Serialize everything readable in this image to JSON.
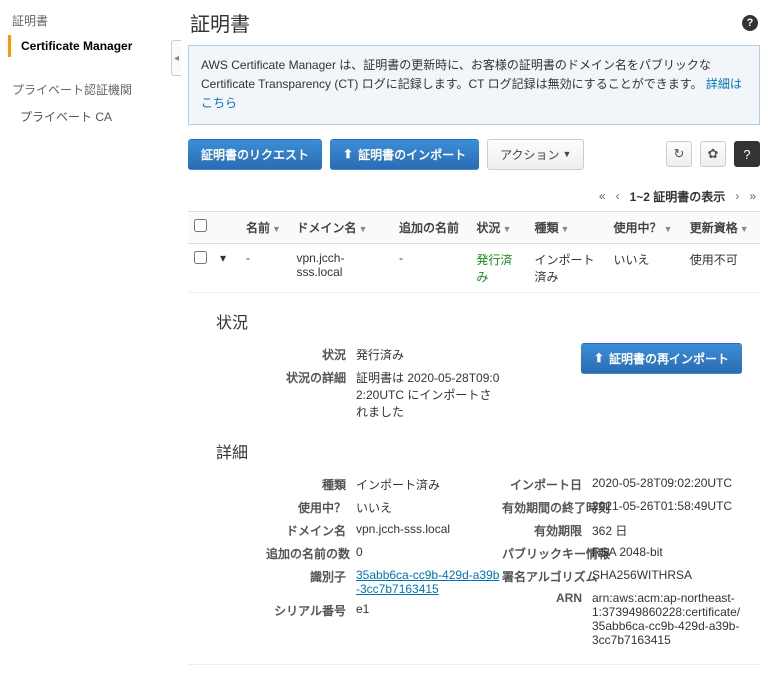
{
  "sidebar": {
    "header1": "証明書",
    "item_active": "Certificate Manager",
    "header2": "プライベート認証機関",
    "item_sub": "プライベート CA"
  },
  "page": {
    "title": "証明書",
    "help": "?"
  },
  "banner": {
    "text": "AWS Certificate Manager は、証明書の更新時に、お客様の証明書のドメイン名をパブリックな Certificate Transparency (CT) ログに記録します。CT ログ記録は無効にすることができます。 ",
    "link": "詳細はこちら"
  },
  "buttons": {
    "request": "証明書のリクエスト",
    "import": "証明書のインポート",
    "actions": "アクション",
    "reimport": "証明書の再インポート"
  },
  "pager": {
    "left2": "«",
    "left1": "‹",
    "text": "1~2 証明書の表示",
    "right1": "›",
    "right2": "»"
  },
  "columns": {
    "name": "名前",
    "domain": "ドメイン名",
    "additional": "追加の名前",
    "status": "状況",
    "type": "種類",
    "inuse": "使用中？",
    "renewal": "更新資格"
  },
  "row": {
    "name": "-",
    "domain": "vpn.jcch-sss.local",
    "additional": "-",
    "status": "発行済み",
    "type": "インポート済み",
    "inuse": "いいえ",
    "renewal": "使用不可"
  },
  "status_section": {
    "heading": "状況",
    "status_label": "状況",
    "status_value": "発行済み",
    "detail_label": "状況の詳細",
    "detail_value": "証明書は 2020-05-28T09:02:20UTC にインポートされました"
  },
  "detail_section": {
    "heading": "詳細",
    "left": {
      "type_l": "種類",
      "type_v": "インポート済み",
      "inuse_l": "使用中？",
      "inuse_v": "いいえ",
      "domain_l": "ドメイン名",
      "domain_v": "vpn.jcch-sss.local",
      "add_l": "追加の名前の数",
      "add_v": "0",
      "id_l": "識別子",
      "id_v": "35abb6ca-cc9b-429d-a39b-3cc7b7163415",
      "serial_l": "シリアル番号",
      "serial_v": "e1"
    },
    "right": {
      "import_l": "インポート日",
      "import_v": "2020-05-28T09:02:20UTC",
      "exp_l": "有効期間の終了時刻",
      "exp_v": "2021-05-26T01:58:49UTC",
      "days_l": "有効期限",
      "days_v": "362 日",
      "pk_l": "パブリックキー情報",
      "pk_v": "RSA 2048-bit",
      "sig_l": "署名アルゴリズム",
      "sig_v": "SHA256WITHRSA",
      "arn_l": "ARN",
      "arn_v": "arn:aws:acm:ap-northeast-1:373949860228:certificate/35abb6ca-cc9b-429d-a39b-3cc7b7163415"
    }
  }
}
